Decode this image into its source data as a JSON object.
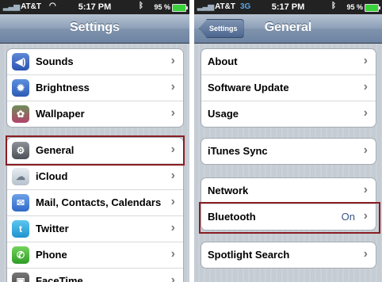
{
  "left": {
    "status": {
      "carrier": "AT&T",
      "time": "5:17 PM",
      "battery": "95 %"
    },
    "nav": {
      "title": "Settings"
    },
    "group1": [
      {
        "label": "Sounds",
        "icon": "speaker-icon"
      },
      {
        "label": "Brightness",
        "icon": "sun-icon"
      },
      {
        "label": "Wallpaper",
        "icon": "flower-icon"
      }
    ],
    "group2": [
      {
        "label": "General",
        "icon": "gear-icon"
      },
      {
        "label": "iCloud",
        "icon": "cloud-icon"
      },
      {
        "label": "Mail, Contacts, Calendars",
        "icon": "envelope-icon"
      },
      {
        "label": "Twitter",
        "icon": "bird-icon"
      },
      {
        "label": "Phone",
        "icon": "phone-icon"
      },
      {
        "label": "FaceTime",
        "icon": "camera-icon"
      }
    ]
  },
  "right": {
    "status": {
      "carrier": "AT&T",
      "network": "3G",
      "time": "5:17 PM",
      "battery": "95 %"
    },
    "nav": {
      "title": "General",
      "back": "Settings"
    },
    "group1": [
      {
        "label": "About"
      },
      {
        "label": "Software Update"
      },
      {
        "label": "Usage"
      }
    ],
    "group2": [
      {
        "label": "iTunes Sync"
      }
    ],
    "group3": [
      {
        "label": "Network"
      },
      {
        "label": "Bluetooth",
        "value": "On"
      }
    ],
    "group4": [
      {
        "label": "Spotlight Search"
      }
    ]
  },
  "colors": {
    "highlight": "#8a1d22",
    "nav": "#6d84a3"
  }
}
